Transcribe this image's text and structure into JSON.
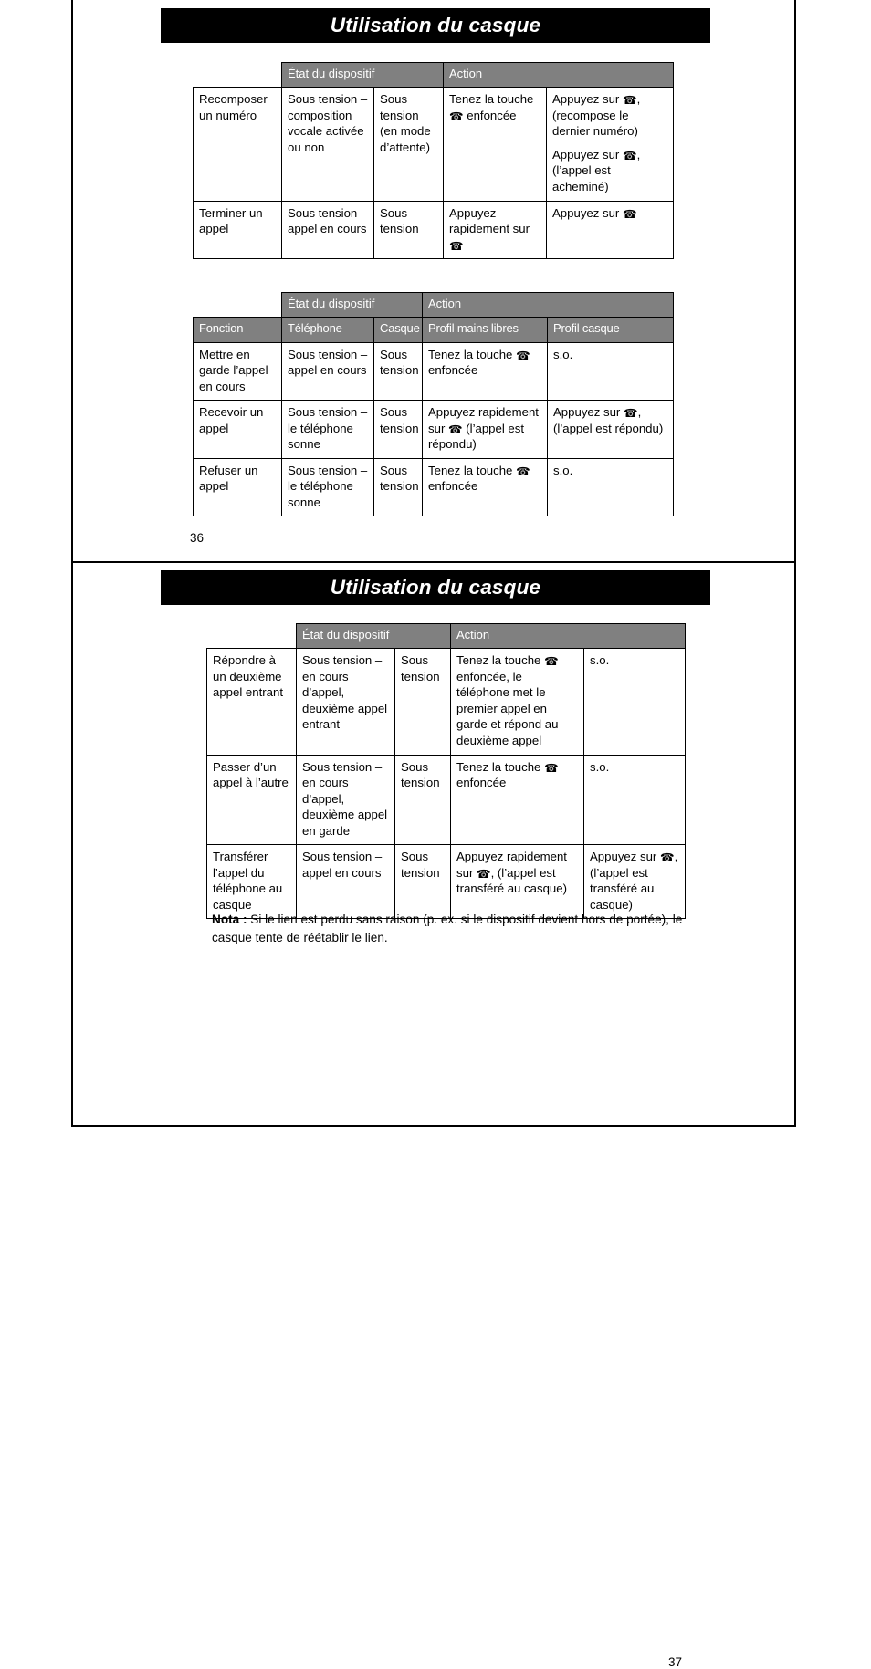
{
  "document": {
    "title": "Utilisation du casque",
    "phone_icon_glyph": "☎",
    "header_gray": "#808080",
    "banner_background": "#000000"
  },
  "pages": [
    {
      "number": "36",
      "banner_title": "Utilisation du casque",
      "tables": [
        {
          "id": "table-dialing",
          "group_headers": [
            {
              "label": "",
              "span": 1,
              "blank": true
            },
            {
              "label": "État du dispositif",
              "span": 2
            },
            {
              "label": "Action",
              "span": 2
            }
          ],
          "rows": [
            {
              "fonction": "Recomposer un numéro",
              "telephone": "Sous tension – composition vocale activée ou non",
              "casque": "Sous tension (en mode d’attente)",
              "profil_mains_libres": [
                "Tenez la touche ☎ enfoncée"
              ],
              "profil_casque": [
                "Appuyez sur ☎, (recompose le dernier numéro)",
                "Appuyez sur ☎, (l’appel est acheminé)"
              ]
            },
            {
              "fonction": "Terminer un appel",
              "telephone": "Sous tension – appel en cours",
              "casque": "Sous tension",
              "profil_mains_libres": [
                "Appuyez rapidement sur ☎"
              ],
              "profil_casque": [
                "Appuyez sur ☎"
              ]
            }
          ]
        },
        {
          "id": "table-callmgmt",
          "group_headers": [
            {
              "label": "",
              "span": 1,
              "blank": true
            },
            {
              "label": "État du dispositif",
              "span": 2
            },
            {
              "label": "Action",
              "span": 2
            }
          ],
          "column_headers": [
            "Fonction",
            "Téléphone",
            "Casque",
            "Profil mains libres",
            "Profil casque"
          ],
          "rows": [
            {
              "fonction": "Mettre en garde l’appel en cours",
              "telephone": "Sous tension – appel en cours",
              "casque": "Sous tension",
              "profil_mains_libres": [
                "Tenez la touche ☎ enfoncée"
              ],
              "profil_casque": [
                "s.o."
              ]
            },
            {
              "fonction": "Recevoir un appel",
              "telephone": "Sous tension – le téléphone sonne",
              "casque": "Sous tension",
              "profil_mains_libres": [
                "Appuyez rapidement sur ☎ (l’appel est répondu)"
              ],
              "profil_casque": [
                "Appuyez sur ☎, (l’appel est répondu)"
              ]
            },
            {
              "fonction": "Refuser un appel",
              "telephone": "Sous tension – le téléphone sonne",
              "casque": "Sous tension",
              "profil_mains_libres": [
                "Tenez la touche ☎ enfoncée"
              ],
              "profil_casque": [
                "s.o."
              ]
            }
          ]
        }
      ]
    },
    {
      "number": "37",
      "banner_title": "Utilisation du casque",
      "tables": [
        {
          "id": "table-advanced",
          "group_headers": [
            {
              "label": "",
              "span": 1,
              "blank": true
            },
            {
              "label": "État du dispositif",
              "span": 2
            },
            {
              "label": "Action",
              "span": 2
            }
          ],
          "rows": [
            {
              "fonction": "Répondre à un deuxième appel entrant",
              "telephone": "Sous tension – en cours d’appel, deuxième appel entrant",
              "casque": "Sous tension",
              "profil_mains_libres": [
                "Tenez la touche ☎ enfoncée, le téléphone met le premier appel en garde et répond au deuxième appel"
              ],
              "profil_casque": [
                "s.o."
              ]
            },
            {
              "fonction": "Passer d’un appel à l’autre",
              "telephone": "Sous tension – en cours d’appel, deuxième appel en garde",
              "casque": "Sous tension",
              "profil_mains_libres": [
                "Tenez la touche ☎ enfoncée"
              ],
              "profil_casque": [
                "s.o."
              ]
            },
            {
              "fonction": "Transférer l’appel du téléphone au casque",
              "telephone": "Sous tension – appel en cours",
              "casque": "Sous tension",
              "profil_mains_libres": [
                "Appuyez rapidement sur ☎, (l’appel est transféré au casque)"
              ],
              "profil_casque": [
                "Appuyez sur ☎, (l’appel est transféré au casque)"
              ]
            }
          ]
        }
      ],
      "note": {
        "label": "Nota :",
        "text": "Si le lien est perdu sans raison (p. ex. si le dispositif devient hors de portée), le casque tente de réétablir le lien."
      }
    }
  ]
}
